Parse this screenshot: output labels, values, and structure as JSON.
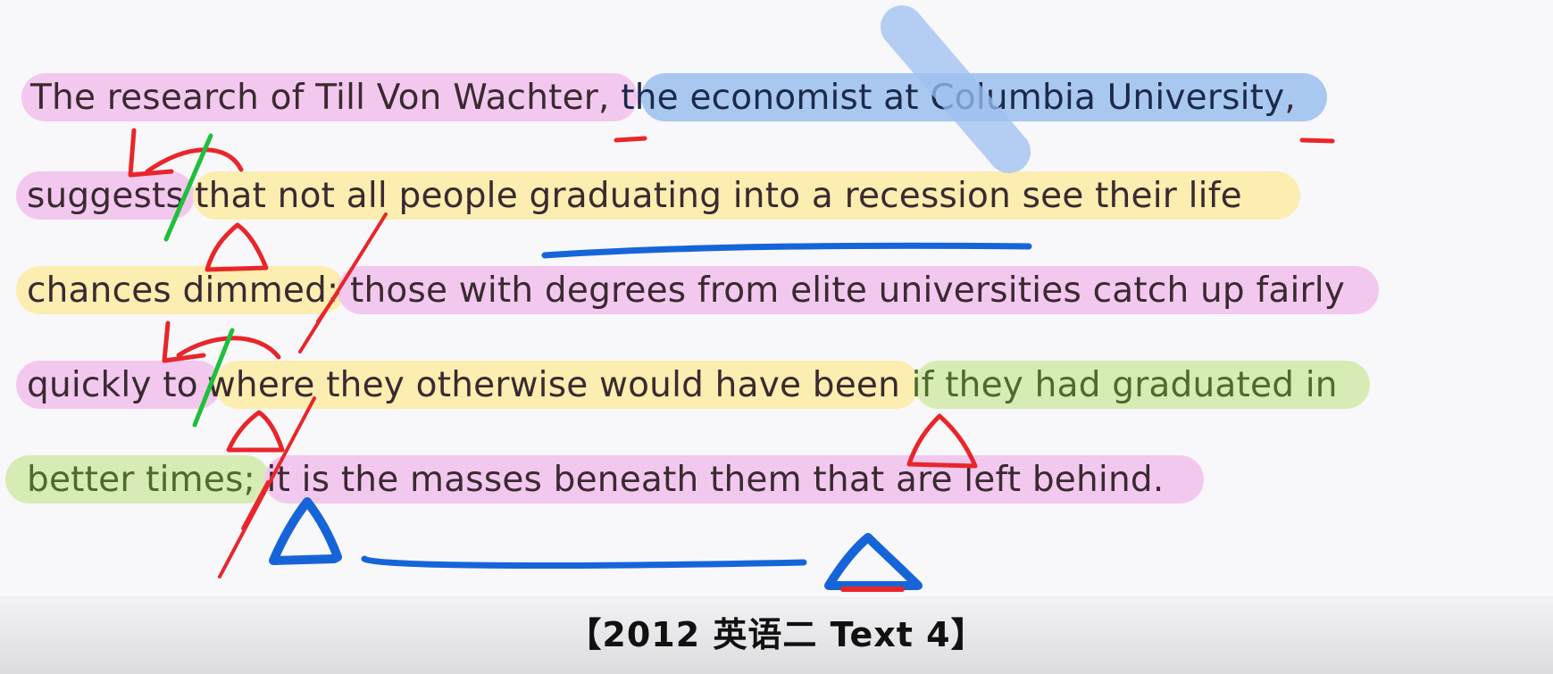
{
  "passage": {
    "line1": {
      "subject": "The research of Till Von Wachter",
      "comma1": ", ",
      "appositive": "the economist at Columbia University",
      "comma2": ","
    },
    "line2": {
      "verb": "suggests",
      "clause_start": "that not all people ",
      "clause_underlined": "graduating into a recession",
      "clause_end": " see their life"
    },
    "line3": {
      "clause_end": "chances dimmed:",
      "second_clause": " those with degrees from elite universities catch up fairly"
    },
    "line4": {
      "lead": "quickly to",
      "where_clause": "where they otherwise would have been",
      "if_clause": " if they had graduated in"
    },
    "line5": {
      "if_clause_end": "better times;",
      "lead": " it is ",
      "underlined": "the masses beneath them",
      "tail": " that are left behind."
    }
  },
  "citation": "【2012 英语二 Text 4】",
  "colors": {
    "pink_highlight": "#f3c8ef",
    "blue_highlight": "#a9c8f0",
    "yellow_highlight": "#fbeeb0",
    "green_highlight": "#d6ecb4",
    "red_mark": "#e8262a",
    "blue_mark": "#1565d8",
    "green_mark": "#1fbf3c"
  }
}
